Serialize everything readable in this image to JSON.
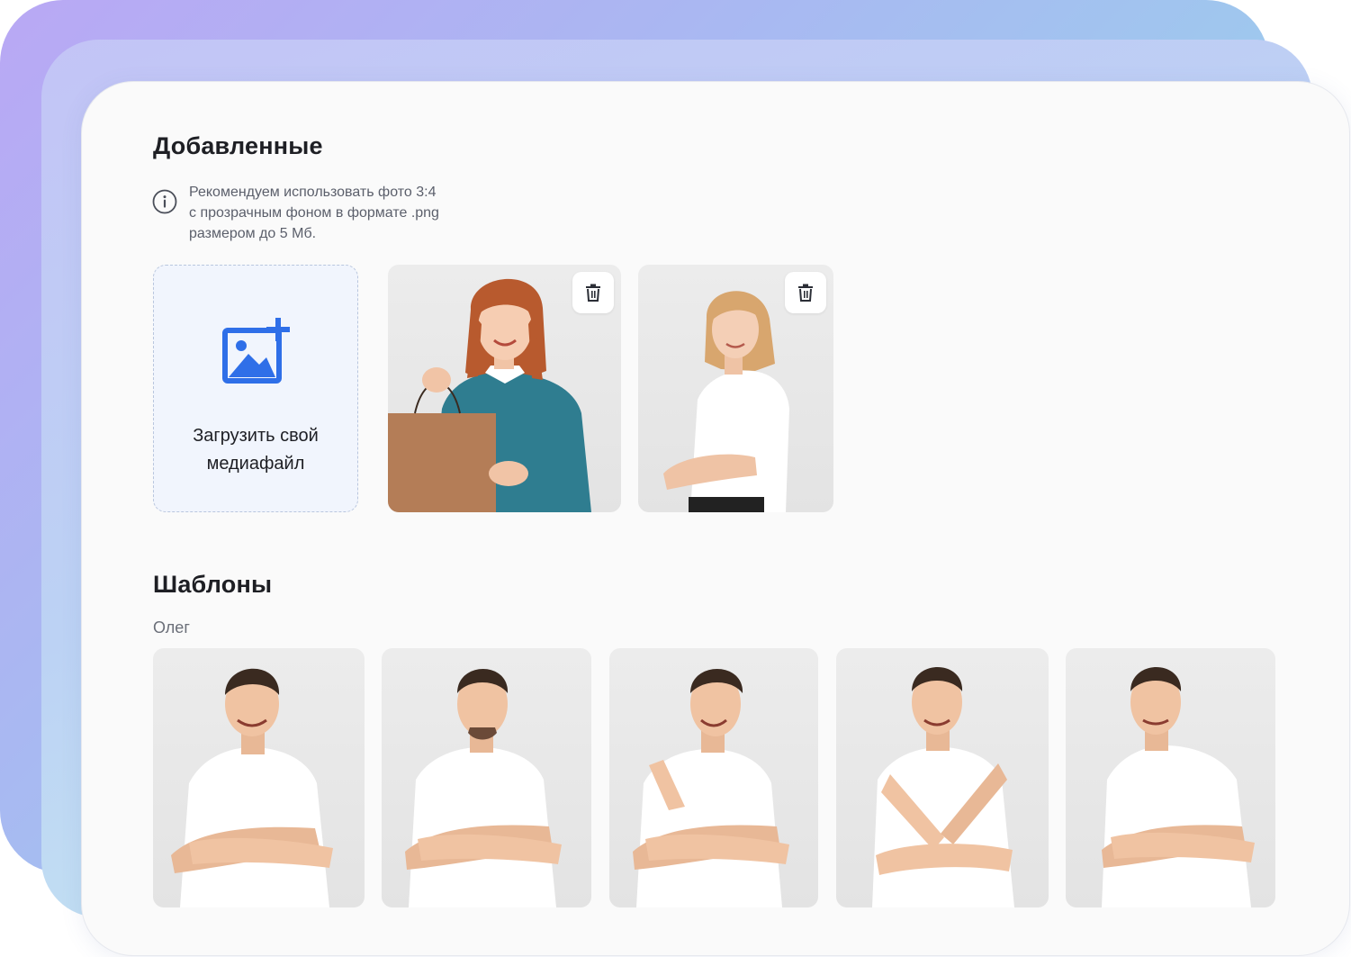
{
  "added": {
    "title": "Добавленные",
    "info_icon": "info-icon",
    "info_lines": [
      "Рекомендуем использовать фото 3:4",
      "с прозрачным фоном в формате .png",
      "размером до 5 Мб."
    ],
    "upload": {
      "icon": "add-image-icon",
      "label_lines": [
        "Загрузить свой",
        "медиафайл"
      ]
    },
    "photos": [
      {
        "icon": "trash-icon"
      },
      {
        "icon": "trash-icon"
      }
    ]
  },
  "templates": {
    "title": "Шаблоны",
    "group_label": "Олег"
  },
  "colors": {
    "accent": "#2f6fe8",
    "heading": "#1e1f24",
    "muted": "#5b5f6b"
  }
}
